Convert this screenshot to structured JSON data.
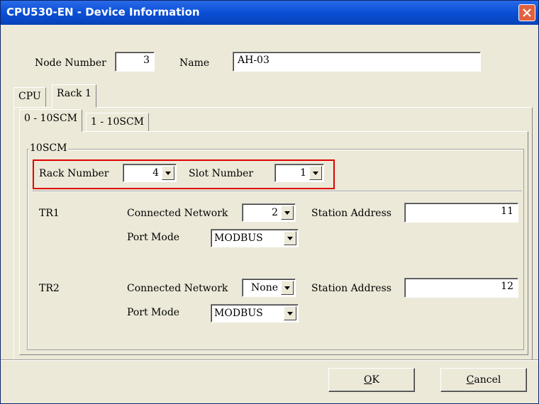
{
  "window": {
    "title": "CPU530-EN - Device Information"
  },
  "header": {
    "node_number_label": "Node Number",
    "node_number_value": "3",
    "name_label": "Name",
    "name_value": "AH-03"
  },
  "tabs": {
    "outer": [
      "CPU",
      "Rack 1"
    ],
    "inner": [
      "0 - 10SCM",
      "1 - 10SCM"
    ]
  },
  "group": {
    "title": "10SCM",
    "rack_number_label": "Rack Number",
    "rack_number_value": "4",
    "slot_number_label": "Slot Number",
    "slot_number_value": "1"
  },
  "tr1": {
    "label": "TR1",
    "connected_network_label": "Connected Network",
    "connected_network_value": "2",
    "station_address_label": "Station Address",
    "station_address_value": "11",
    "port_mode_label": "Port Mode",
    "port_mode_value": "MODBUS"
  },
  "tr2": {
    "label": "TR2",
    "connected_network_label": "Connected Network",
    "connected_network_value": "None",
    "station_address_label": "Station Address",
    "station_address_value": "12",
    "port_mode_label": "Port Mode",
    "port_mode_value": "MODBUS"
  },
  "buttons": {
    "ok_label_mnemonic": "O",
    "ok_label_rest": "K",
    "cancel_label_mnemonic": "C",
    "cancel_label_rest": "ancel"
  },
  "colors": {
    "highlight": "#e00000",
    "titlebar": "#0a4fd6"
  }
}
